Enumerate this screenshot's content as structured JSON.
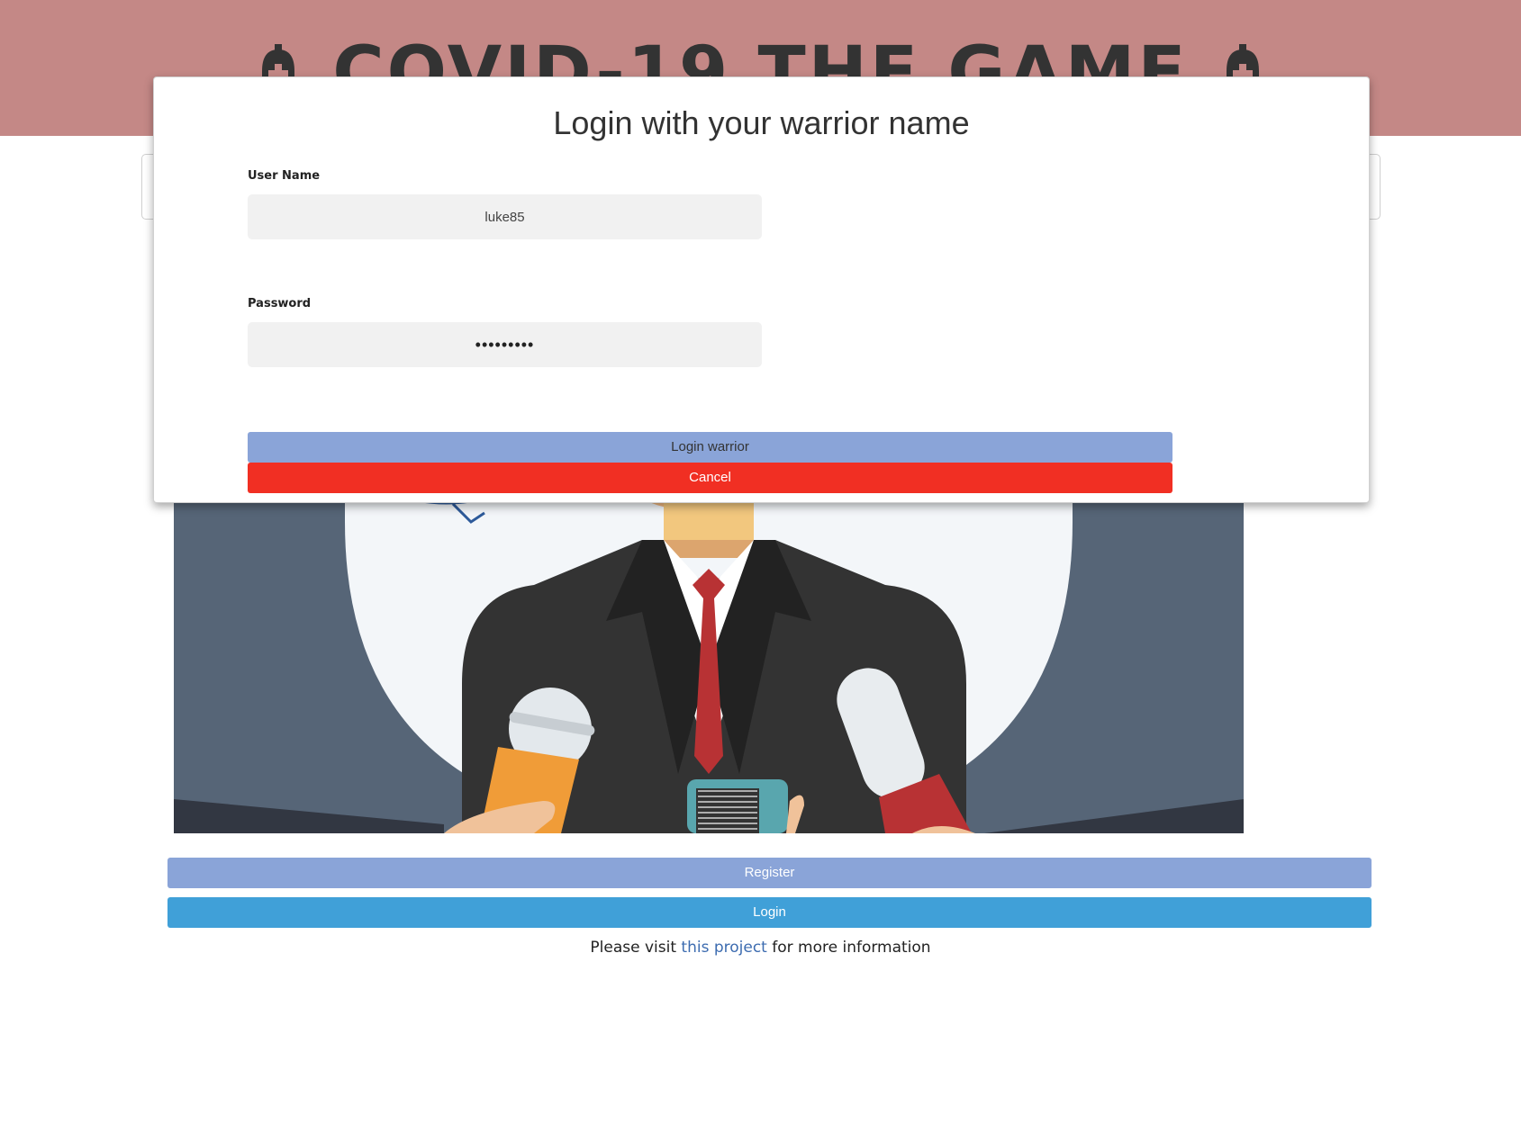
{
  "header": {
    "title": "COVID-19 THE GAME",
    "left_icon": "helmet-cross-icon",
    "right_icon": "helmet-cross-icon",
    "background_color": "#c48886"
  },
  "modal": {
    "title": "Login with your warrior name",
    "username": {
      "label": "User Name",
      "value": "luke85"
    },
    "password": {
      "label": "Password",
      "value": "•••••••••"
    },
    "login_button": "Login warrior",
    "cancel_button": "Cancel"
  },
  "illustration": {
    "subject": "press-conference-speaker"
  },
  "actions": {
    "register_label": "Register",
    "login_label": "Login"
  },
  "footer": {
    "prefix": "Please visit ",
    "link_text": "this project",
    "suffix": " for more information"
  },
  "colors": {
    "accent_blue": "#8aa4d8",
    "login_blue": "#40a0d8",
    "cancel_red": "#f12f23",
    "link": "#3d6cb0"
  }
}
